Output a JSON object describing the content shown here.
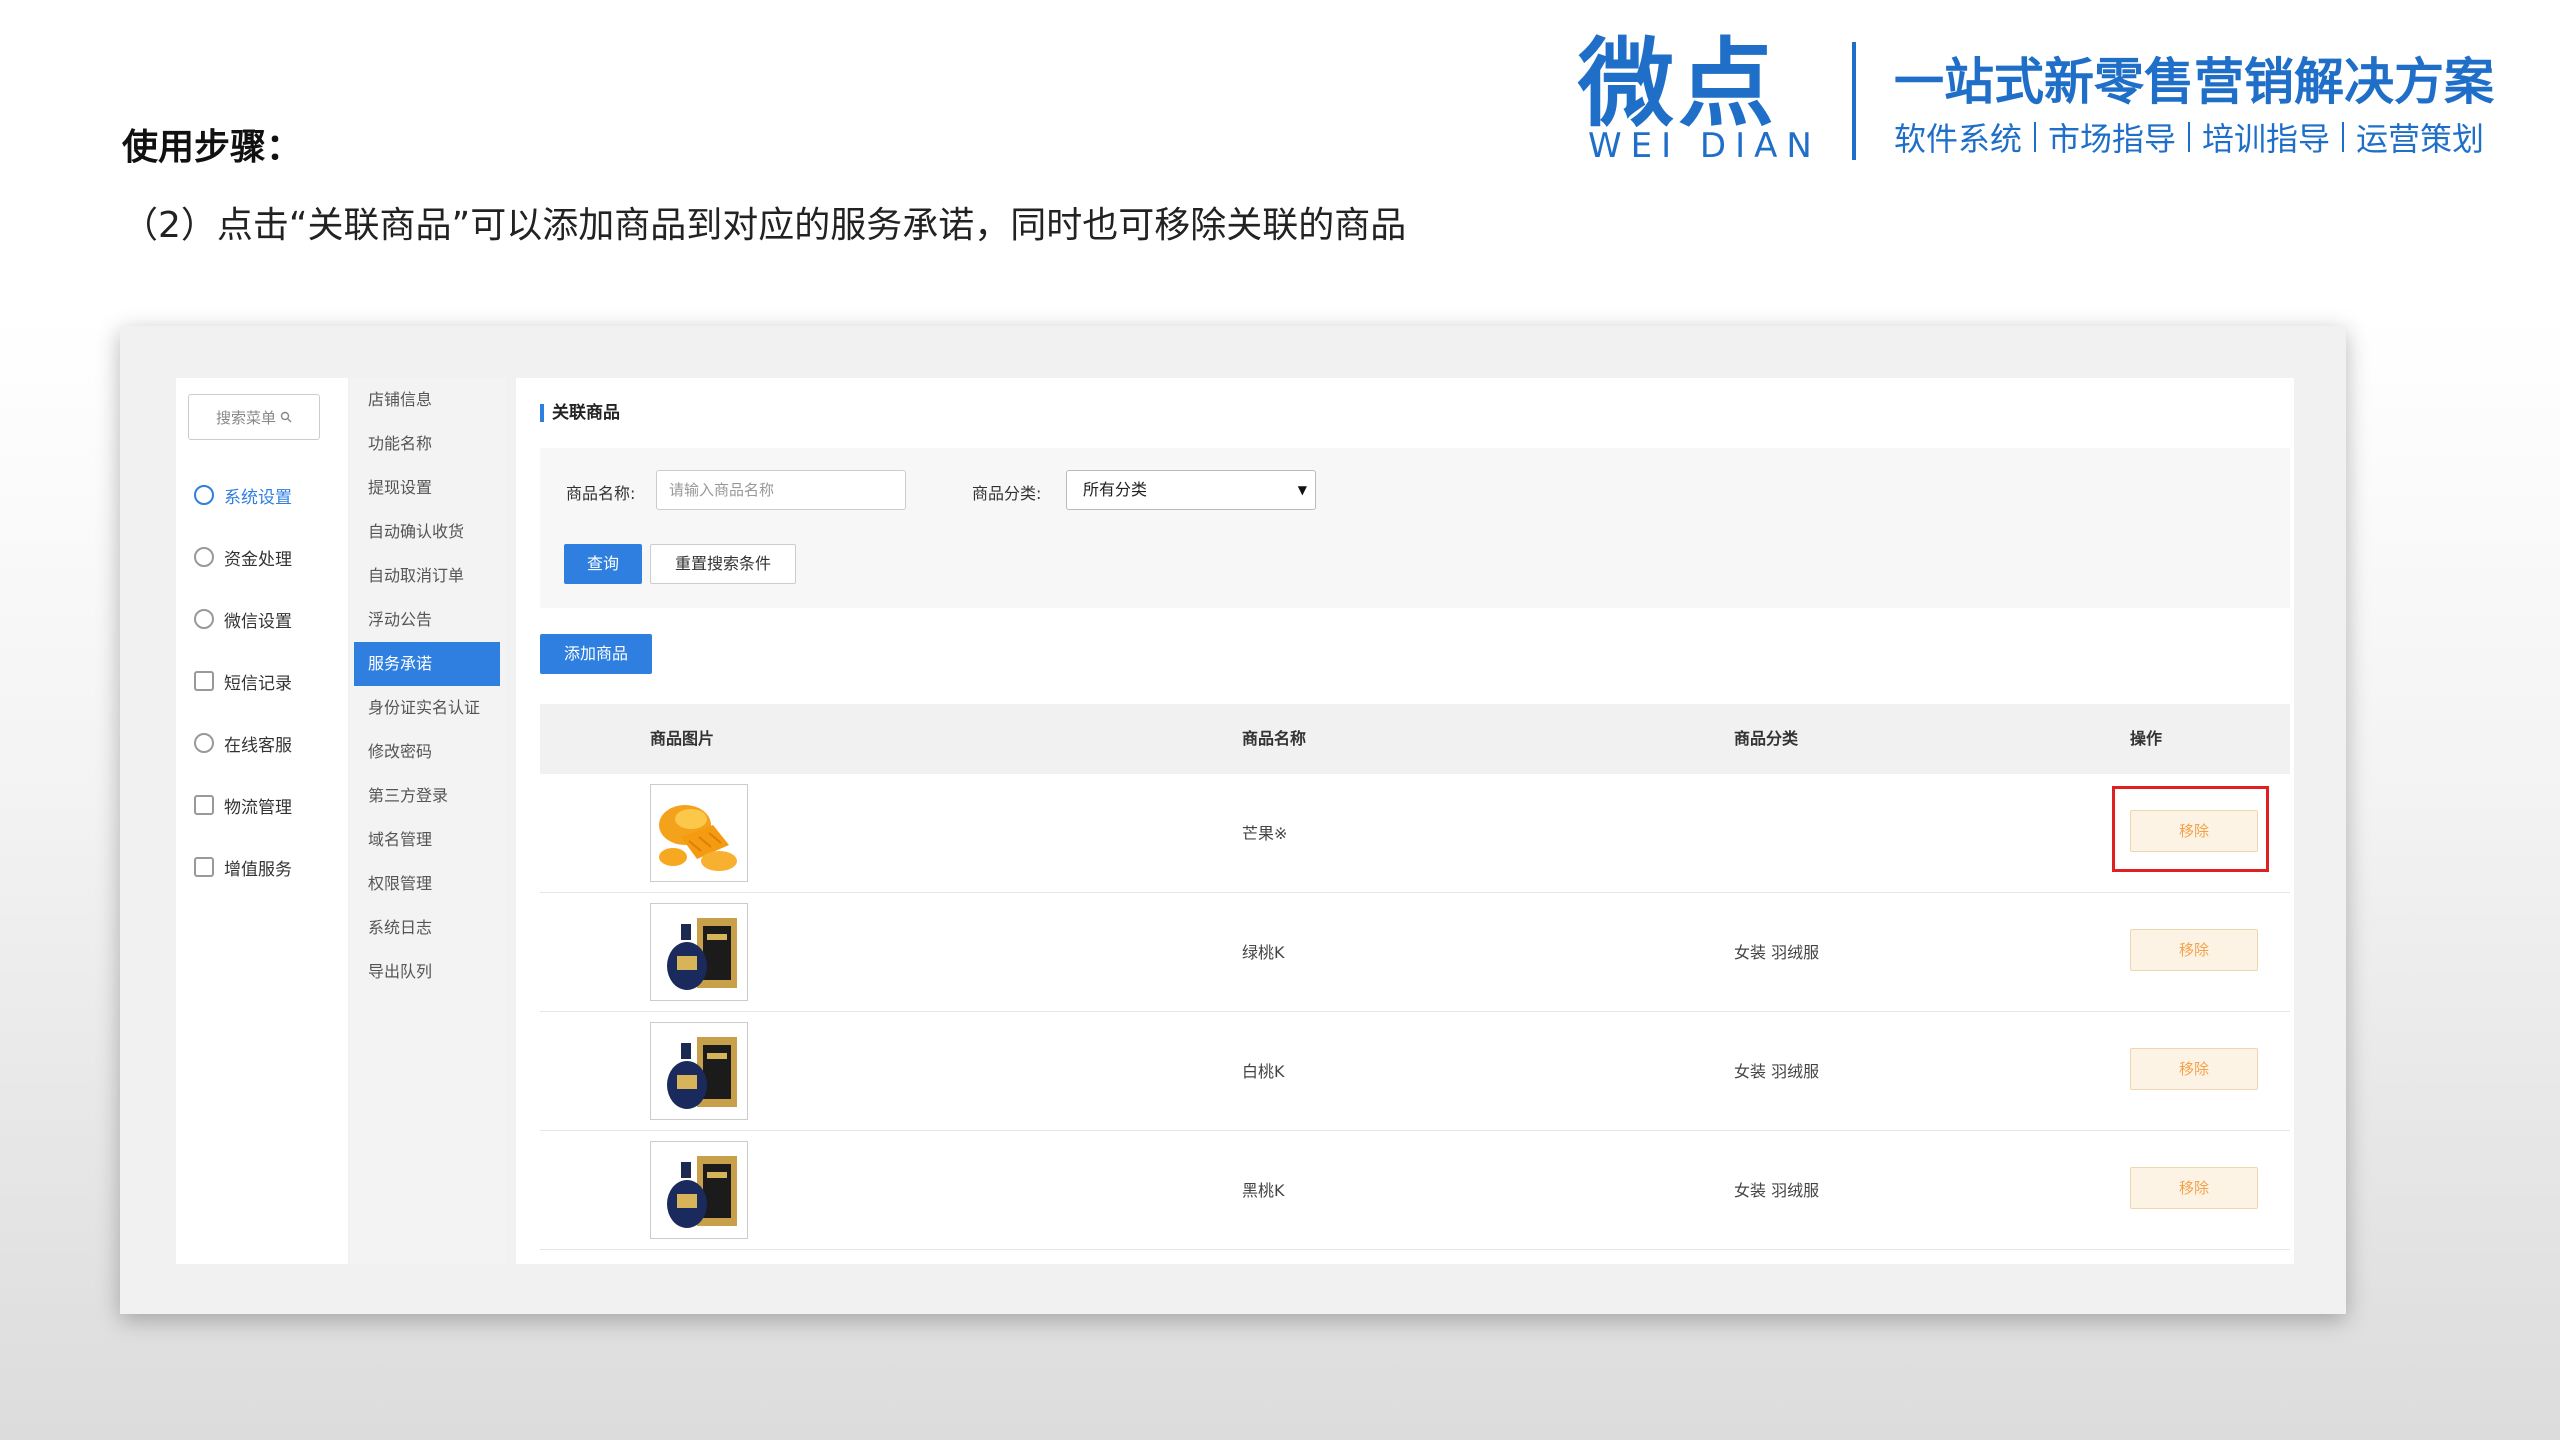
{
  "slide": {
    "step_title": "使用步骤：",
    "step_desc": "（2）点击“关联商品”可以添加商品到对应的服务承诺，同时也可移除关联的商品"
  },
  "brand": {
    "logo": "微点",
    "logo_sub": "WEI DIAN",
    "slogan": "一站式新零售营销解决方案",
    "items": [
      "软件系统",
      "市场指导",
      "培训指导",
      "运营策划"
    ]
  },
  "sidebar": {
    "search_placeholder": "搜索菜单",
    "items": [
      {
        "label": "系统设置",
        "icon": "gear-icon",
        "active": true
      },
      {
        "label": "资金处理",
        "icon": "money-icon"
      },
      {
        "label": "微信设置",
        "icon": "wechat-icon"
      },
      {
        "label": "短信记录",
        "icon": "mail-icon"
      },
      {
        "label": "在线客服",
        "icon": "headset-icon"
      },
      {
        "label": "物流管理",
        "icon": "truck-icon"
      },
      {
        "label": "增值服务",
        "icon": "chart-icon"
      }
    ]
  },
  "submenu": {
    "items": [
      "店铺信息",
      "功能名称",
      "提现设置",
      "自动确认收货",
      "自动取消订单",
      "浮动公告",
      "服务承诺",
      "身份证实名认证",
      "修改密码",
      "第三方登录",
      "域名管理",
      "权限管理",
      "系统日志",
      "导出队列"
    ],
    "active_index": 6
  },
  "content": {
    "title": "关联商品",
    "search": {
      "name_label": "商品名称:",
      "name_placeholder": "请输入商品名称",
      "category_label": "商品分类:",
      "category_value": "所有分类",
      "query_button": "查询",
      "reset_button": "重置搜索条件"
    },
    "add_button": "添加商品",
    "table": {
      "columns": [
        "商品图片",
        "商品名称",
        "商品分类",
        "操作"
      ],
      "rows": [
        {
          "name": "芒果※",
          "category": "",
          "action": "移除",
          "image": "mango"
        },
        {
          "name": "绿桃K",
          "category": "女装 羽绒服",
          "action": "移除",
          "image": "bottle"
        },
        {
          "name": "白桃K",
          "category": "女装 羽绒服",
          "action": "移除",
          "image": "bottle"
        },
        {
          "name": "黑桃K",
          "category": "女装 羽绒服",
          "action": "移除",
          "image": "bottle"
        }
      ]
    }
  },
  "colors": {
    "brand": "#1f6fc8",
    "primary": "#2f7fe0",
    "remove_text": "#f2a24a",
    "highlight": "#e02020"
  }
}
